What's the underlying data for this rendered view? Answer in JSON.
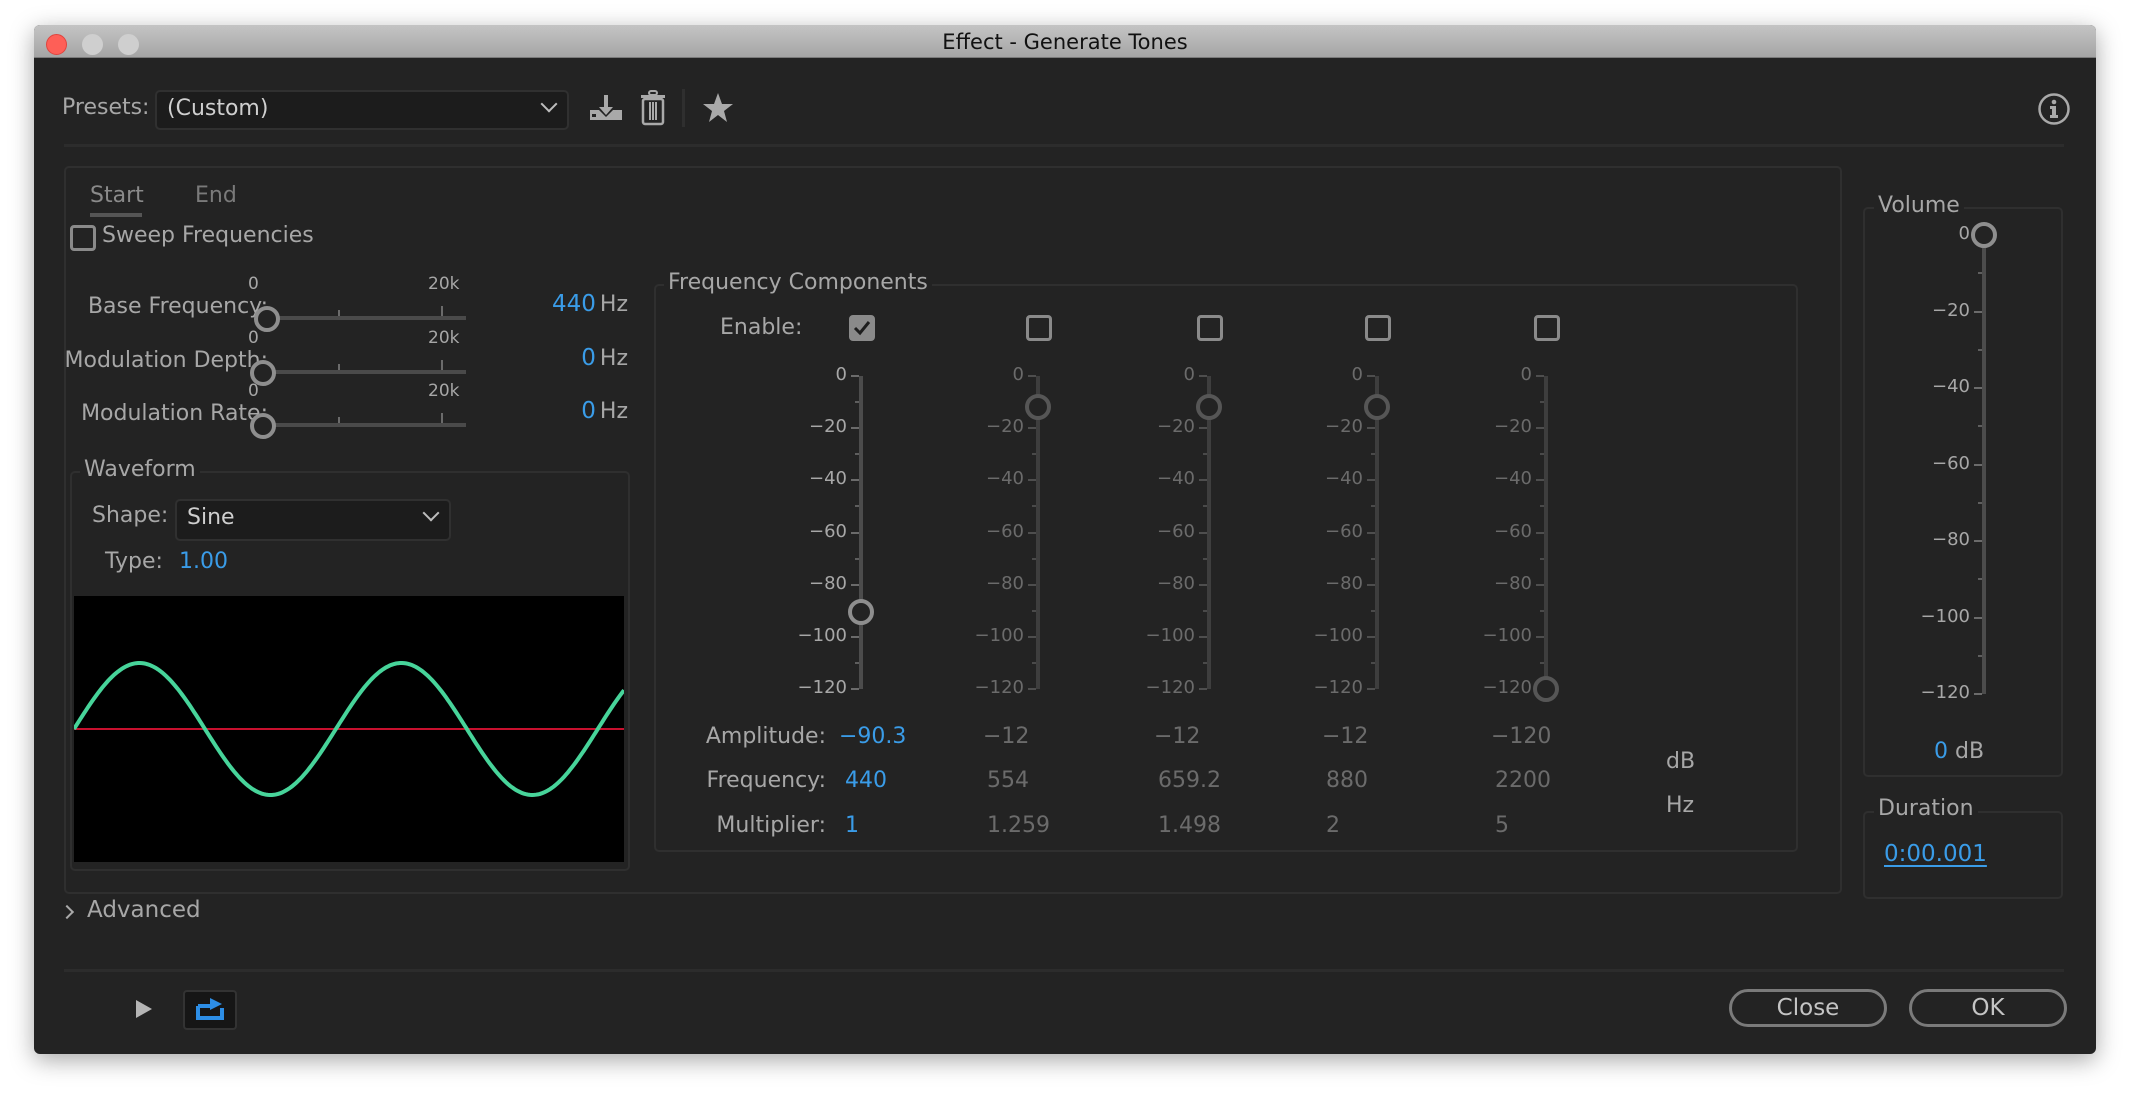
{
  "window": {
    "title": "Effect - Generate Tones",
    "traffic_lights": [
      "close",
      "minimize",
      "zoom"
    ],
    "colors": {
      "close": "#fe5f57",
      "inactive": "#cfcfcf"
    }
  },
  "toolbar": {
    "presets_label": "Presets:",
    "presets_value": "(Custom)",
    "icons": [
      "download-preset-icon",
      "trash-icon",
      "star-icon",
      "info-icon"
    ]
  },
  "tabs": [
    {
      "label": "Start",
      "active": true
    },
    {
      "label": "End",
      "active": false
    }
  ],
  "sweep": {
    "label": "Sweep Frequencies",
    "checked": false
  },
  "params": [
    {
      "label": "Base Frequency:",
      "min_label": "0",
      "max_label": "20k",
      "value": "440",
      "unit": "Hz",
      "slider_fraction": 0.022
    },
    {
      "label": "Modulation Depth:",
      "min_label": "0",
      "max_label": "20k",
      "value": "0",
      "unit": "Hz",
      "slider_fraction": 0.0
    },
    {
      "label": "Modulation Rate:",
      "min_label": "0",
      "max_label": "20k",
      "value": "0",
      "unit": "Hz",
      "slider_fraction": 0.0
    }
  ],
  "waveform": {
    "legend": "Waveform",
    "shape_label": "Shape:",
    "shape_value": "Sine",
    "type_label": "Type:",
    "type_value": "1.00",
    "cycles_shown": 2.1,
    "colors": {
      "wave": "#47d49a",
      "baseline": "#c8102e",
      "background": "#000000"
    }
  },
  "frequency_components": {
    "legend": "Frequency Components",
    "enable_label": "Enable:",
    "scale_ticks": [
      "0",
      "−20",
      "−40",
      "−60",
      "−80",
      "−100",
      "−120"
    ],
    "row_labels": {
      "amplitude": "Amplitude:",
      "frequency": "Frequency:",
      "multiplier": "Multiplier:"
    },
    "units": {
      "amplitude": "dB",
      "frequency": "Hz"
    },
    "components": [
      {
        "enabled": true,
        "amplitude": "−90.3",
        "amplitude_db": -90.3,
        "frequency": "440",
        "multiplier": "1"
      },
      {
        "enabled": false,
        "amplitude": "−12",
        "amplitude_db": -12,
        "frequency": "554",
        "multiplier": "1.259"
      },
      {
        "enabled": false,
        "amplitude": "−12",
        "amplitude_db": -12,
        "frequency": "659.2",
        "multiplier": "1.498"
      },
      {
        "enabled": false,
        "amplitude": "−12",
        "amplitude_db": -12,
        "frequency": "880",
        "multiplier": "2"
      },
      {
        "enabled": false,
        "amplitude": "−120",
        "amplitude_db": -120,
        "frequency": "2200",
        "multiplier": "5"
      }
    ]
  },
  "volume": {
    "legend": "Volume",
    "scale_ticks": [
      "0",
      "−20",
      "−40",
      "−60",
      "−80",
      "−100",
      "−120"
    ],
    "value": "0",
    "value_db": 0,
    "unit": "dB"
  },
  "duration": {
    "legend": "Duration",
    "value": "0:00.001"
  },
  "advanced": {
    "label": "Advanced",
    "expanded": false
  },
  "footer": {
    "play_icon": "play-icon",
    "loop_icon": "loop-icon",
    "close_label": "Close",
    "ok_label": "OK"
  }
}
